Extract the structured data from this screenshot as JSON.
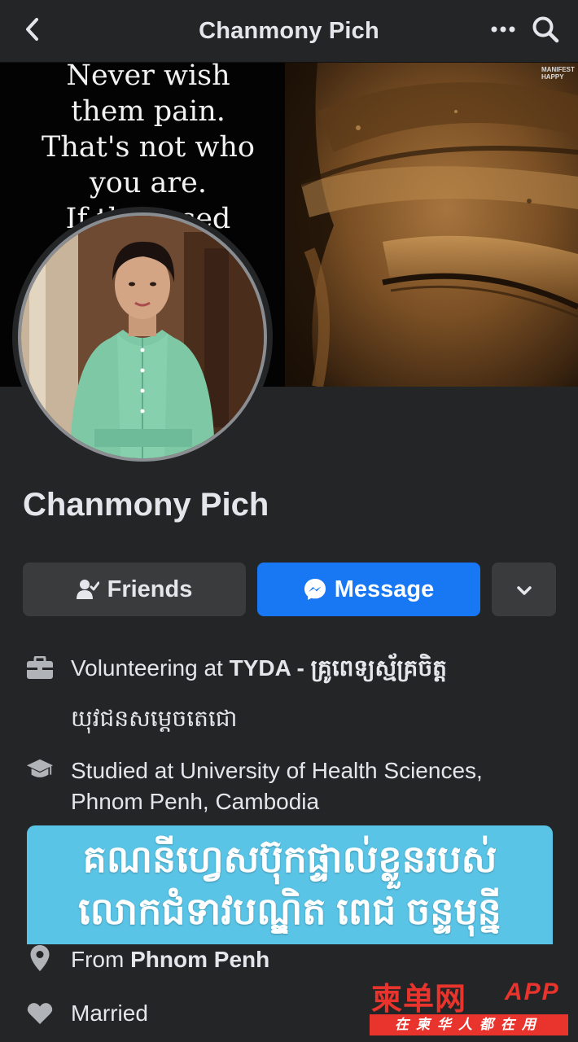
{
  "header": {
    "title": "Chanmony Pich",
    "back_icon": "chevron-left-icon",
    "more_icon": "more-dots-icon",
    "search_icon": "search-icon"
  },
  "cover": {
    "quote_lines": [
      "Never wish",
      "them pain.",
      "That's not who",
      "you are.",
      "If th    used"
    ],
    "corner_stamp": [
      "MANIFEST",
      "HAPPY"
    ]
  },
  "profile": {
    "name": "Chanmony Pich"
  },
  "actions": {
    "friends_label": "Friends",
    "message_label": "Message",
    "dropdown_icon": "chevron-down-icon",
    "message_color": "#1877f2"
  },
  "intro": {
    "work_prefix": "Volunteering at ",
    "work_org": "TYDA - គ្រូពេទ្យស្ម័គ្រចិត្ត",
    "work_line2": "យុវជនសម្តេចតេជោ",
    "study_line1": "Studied at University of Health Sciences,",
    "study_line2": "Phnom Penh, Cambodia",
    "from_prefix": "From ",
    "from_place": "Phnom Penh",
    "relationship": "Married"
  },
  "banner": {
    "line1": "គណនីហ្វេសប៊ុកផ្ទាល់ខ្លួនរបស់",
    "line2": "លោកជំទាវបណ្ឌិត ពេជ ចន្ទមុន្នី",
    "color": "#5ac4e6"
  },
  "watermark": {
    "brand": "柬单网",
    "app": "APP",
    "slogan": "在柬华人都在用",
    "color": "#e8342c"
  }
}
